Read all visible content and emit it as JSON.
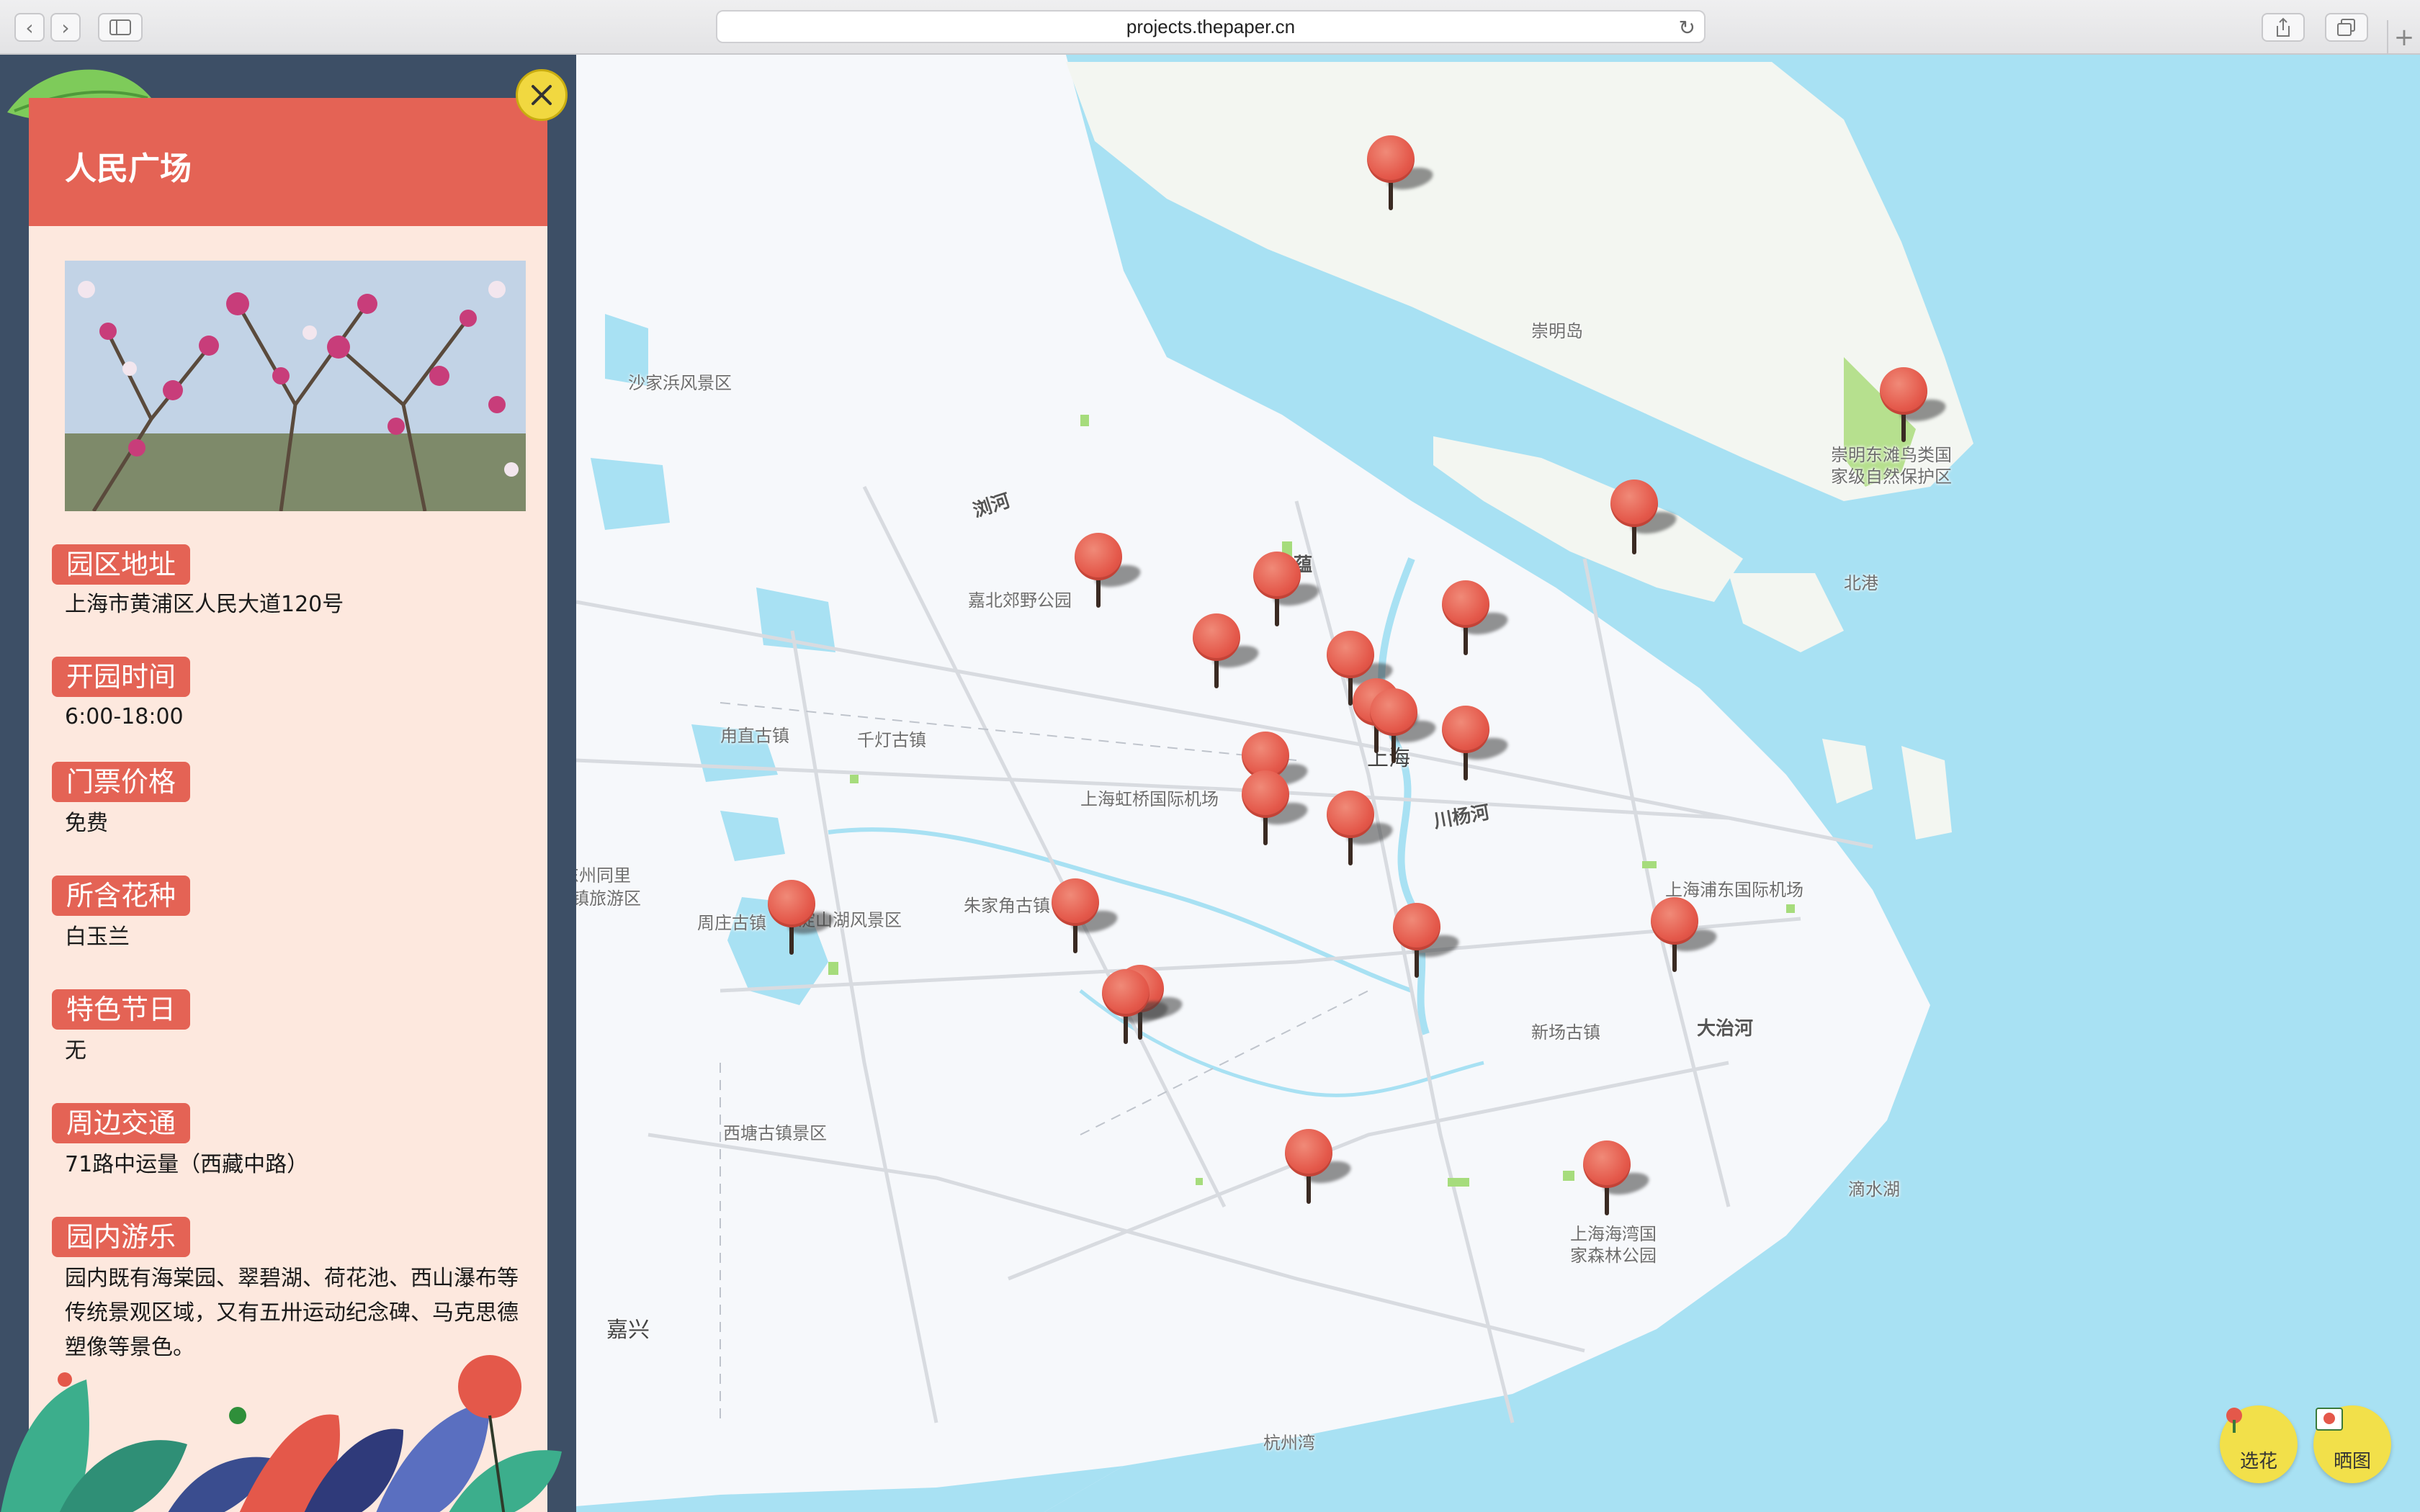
{
  "browser": {
    "url": "projects.thepaper.cn"
  },
  "panel": {
    "title": "人民广场",
    "sections": [
      {
        "label": "园区地址",
        "value": "上海市黄浦区人民大道120号"
      },
      {
        "label": "开园时间",
        "value": "6:00-18:00"
      },
      {
        "label": "门票价格",
        "value": "免费"
      },
      {
        "label": "所含花种",
        "value": "白玉兰"
      },
      {
        "label": "特色节日",
        "value": "无"
      },
      {
        "label": "周边交通",
        "value": "71路中运量（西藏中路）"
      },
      {
        "label": "园内游乐",
        "value": "园内既有海棠园、翠碧湖、荷花池、西山瀑布等传统景观区域，又有五卅运动纪念碑、马克思德塑像等景色。"
      }
    ]
  },
  "map": {
    "labels": {
      "chongming": "崇明岛",
      "shajiabang": "沙家浜风景区",
      "liuhe": "浏河",
      "jiabei": "嘉北郊野公园",
      "lujiao": "蕴",
      "luzhi": "甪直古镇",
      "qiandeng": "千灯古镇",
      "hongqiao": "上海虹桥国际机场",
      "shanghai": "上海",
      "chuanyang": "川杨河",
      "tongli": "东州同里",
      "tongli2": "古镇旅游区",
      "zhouzhuang": "周庄古镇",
      "dianshan": "淀山湖风景区",
      "zhujiajiao": "朱家角古镇",
      "dongtan1": "崇明东滩鸟类国",
      "dongtan2": "家级自然保护区",
      "beigang": "北港",
      "pudong": "上海浦东国际机场",
      "xinchang": "新场古镇",
      "dazhi": "大治河",
      "xitang": "西塘古镇景区",
      "haiwan1": "上海海湾国",
      "haiwan2": "家森林公园",
      "dishui": "滴水湖",
      "jiaxing": "嘉兴",
      "hangzhouwan": "杭州湾"
    },
    "pins": 21
  },
  "buttons": {
    "pick_flower": "选花",
    "share_photo": "晒图"
  },
  "colors": {
    "accent": "#e46355",
    "water": "#a8e1f3",
    "land": "#f6f8fb",
    "panel_bg": "#3d4f66",
    "button": "#f2e04a"
  }
}
